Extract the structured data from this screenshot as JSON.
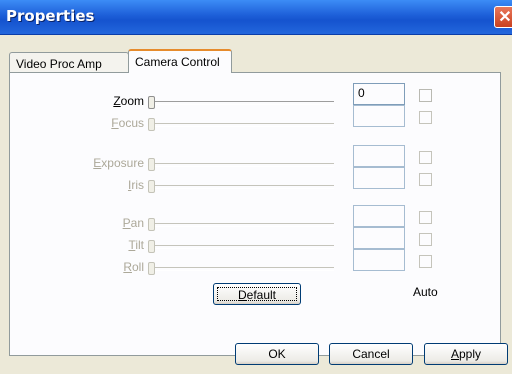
{
  "window": {
    "title": "Properties",
    "close_glyph": "✕"
  },
  "tabs": [
    {
      "label": "Video Proc Amp",
      "selected": false
    },
    {
      "label": "Camera Control",
      "selected": true
    }
  ],
  "controls": [
    {
      "label": "Zoom",
      "mnemonic": "Z",
      "rest": "oom",
      "enabled": true,
      "value": "0",
      "auto": false
    },
    {
      "label": "Focus",
      "mnemonic": "F",
      "rest": "ocus",
      "enabled": false,
      "value": "",
      "auto": false
    },
    {
      "label": "Exposure",
      "mnemonic": "E",
      "rest": "xposure",
      "enabled": false,
      "value": "",
      "auto": false
    },
    {
      "label": "Iris",
      "mnemonic": "I",
      "rest": "ris",
      "enabled": false,
      "value": "",
      "auto": false
    },
    {
      "label": "Pan",
      "mnemonic": "P",
      "rest": "an",
      "enabled": false,
      "value": "",
      "auto": false
    },
    {
      "label": "Tilt",
      "mnemonic": "T",
      "rest": "ilt",
      "enabled": false,
      "value": "",
      "auto": false
    },
    {
      "label": "Roll",
      "mnemonic": "R",
      "rest": "oll",
      "enabled": false,
      "value": "",
      "auto": false
    }
  ],
  "default_button": {
    "mnemonic": "D",
    "rest": "efault"
  },
  "auto_column_label": "Auto",
  "buttons": {
    "ok": "OK",
    "cancel": "Cancel",
    "apply_mnemonic": "A",
    "apply_rest": "pply"
  },
  "colors": {
    "titlebar": "#1d5fd8",
    "dialog_bg": "#ece9d8",
    "disabled_text": "#aca899"
  }
}
